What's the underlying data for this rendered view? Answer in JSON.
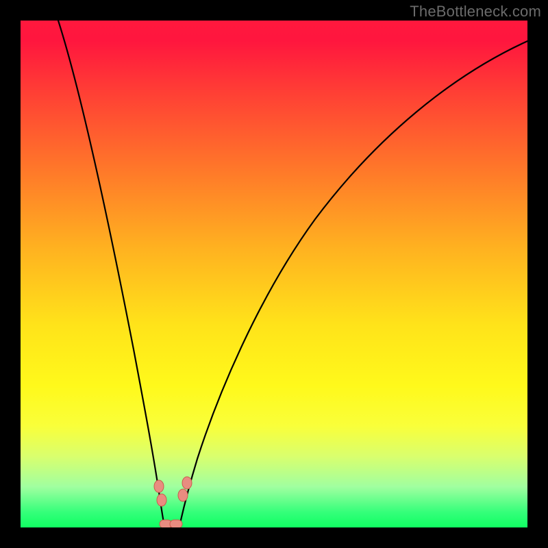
{
  "watermark": "TheBottleneck.com",
  "colors": {
    "gradient_top": "#ff183d",
    "gradient_mid": "#ffe31a",
    "gradient_bottom": "#10ff62",
    "frame": "#000000",
    "curve": "#000000",
    "bead_fill": "#e88c80",
    "bead_stroke": "#ca5b4c"
  },
  "chart_data": {
    "type": "line",
    "title": "",
    "xlabel": "",
    "ylabel": "",
    "xlim": [
      0,
      100
    ],
    "ylim": [
      0,
      100
    ],
    "grid": false,
    "legend": false,
    "description": "Bottleneck-style V curve over red→green vertical gradient. Two black curves descend from upper edges to a shared minimum near x≈28, y≈0, then the right branch rises toward top-right. Small salmon/pink beads mark points near the valley on both branches and along the bottom flat.",
    "series": [
      {
        "name": "left-branch",
        "x": [
          8,
          12,
          16,
          20,
          23,
          25,
          26,
          27,
          27.5
        ],
        "y": [
          100,
          80,
          58,
          36,
          20,
          10,
          5,
          2,
          0
        ]
      },
      {
        "name": "right-branch",
        "x": [
          30,
          31,
          33,
          36,
          40,
          46,
          54,
          64,
          76,
          90,
          100
        ],
        "y": [
          0,
          2,
          6,
          13,
          23,
          36,
          50,
          64,
          78,
          90,
          97
        ]
      },
      {
        "name": "valley-flat",
        "x": [
          27.5,
          28.5,
          30
        ],
        "y": [
          0,
          0,
          0
        ]
      }
    ],
    "markers": [
      {
        "branch": "left",
        "x": 26.0,
        "y": 7.0
      },
      {
        "branch": "left",
        "x": 26.8,
        "y": 4.0
      },
      {
        "branch": "right",
        "x": 31.0,
        "y": 6.0
      },
      {
        "branch": "right",
        "x": 31.8,
        "y": 8.5
      },
      {
        "branch": "flat",
        "x": 27.8,
        "y": 0.0
      },
      {
        "branch": "flat",
        "x": 29.6,
        "y": 0.0
      }
    ]
  }
}
